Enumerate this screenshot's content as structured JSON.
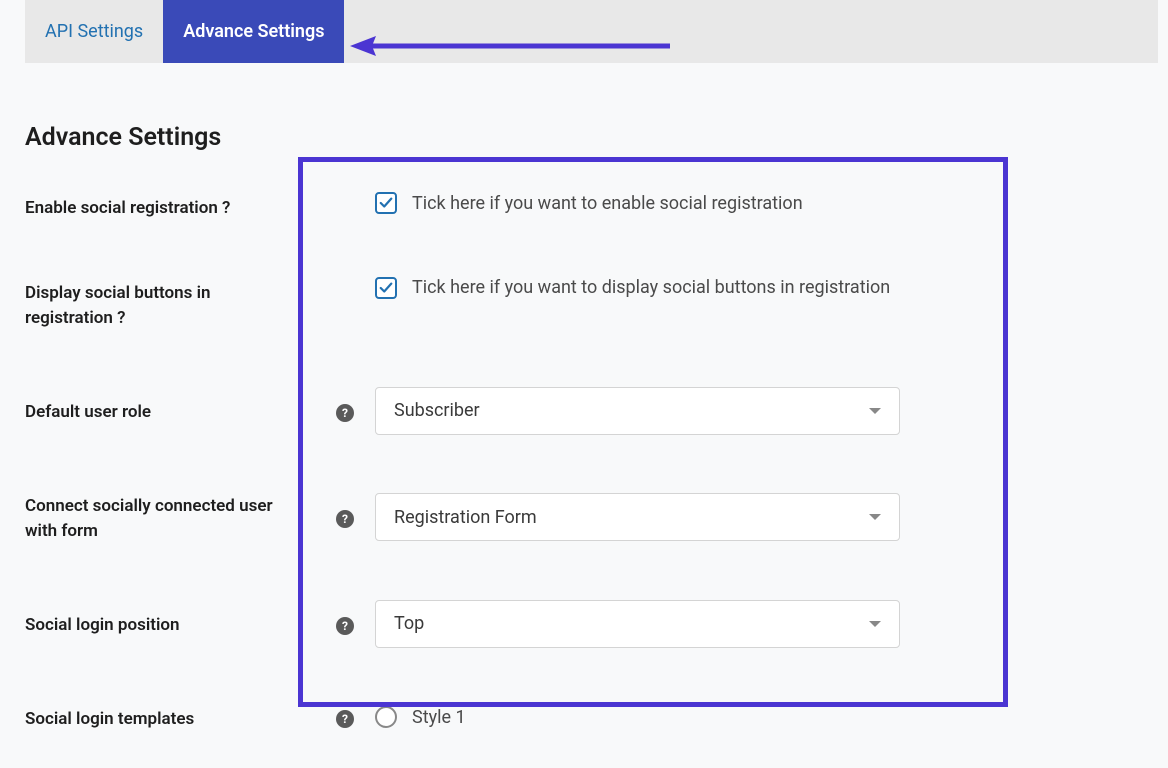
{
  "tabs": {
    "api_settings": "API Settings",
    "advance_settings": "Advance Settings"
  },
  "page_title": "Advance Settings",
  "fields": {
    "enable_social_registration": {
      "label": "Enable social registration ?",
      "checkbox_text": "Tick here if you want to enable social registration",
      "checked": true
    },
    "display_social_buttons": {
      "label": "Display social buttons in registration ?",
      "checkbox_text": "Tick here if you want to display social buttons in registration",
      "checked": true
    },
    "default_user_role": {
      "label": "Default user role",
      "value": "Subscriber"
    },
    "connect_socially": {
      "label": "Connect socially connected user with form",
      "value": "Registration Form"
    },
    "social_login_position": {
      "label": "Social login position",
      "value": "Top"
    },
    "social_login_templates": {
      "label": "Social login templates",
      "radio_value": "Style 1"
    }
  },
  "help_glyph": "?"
}
